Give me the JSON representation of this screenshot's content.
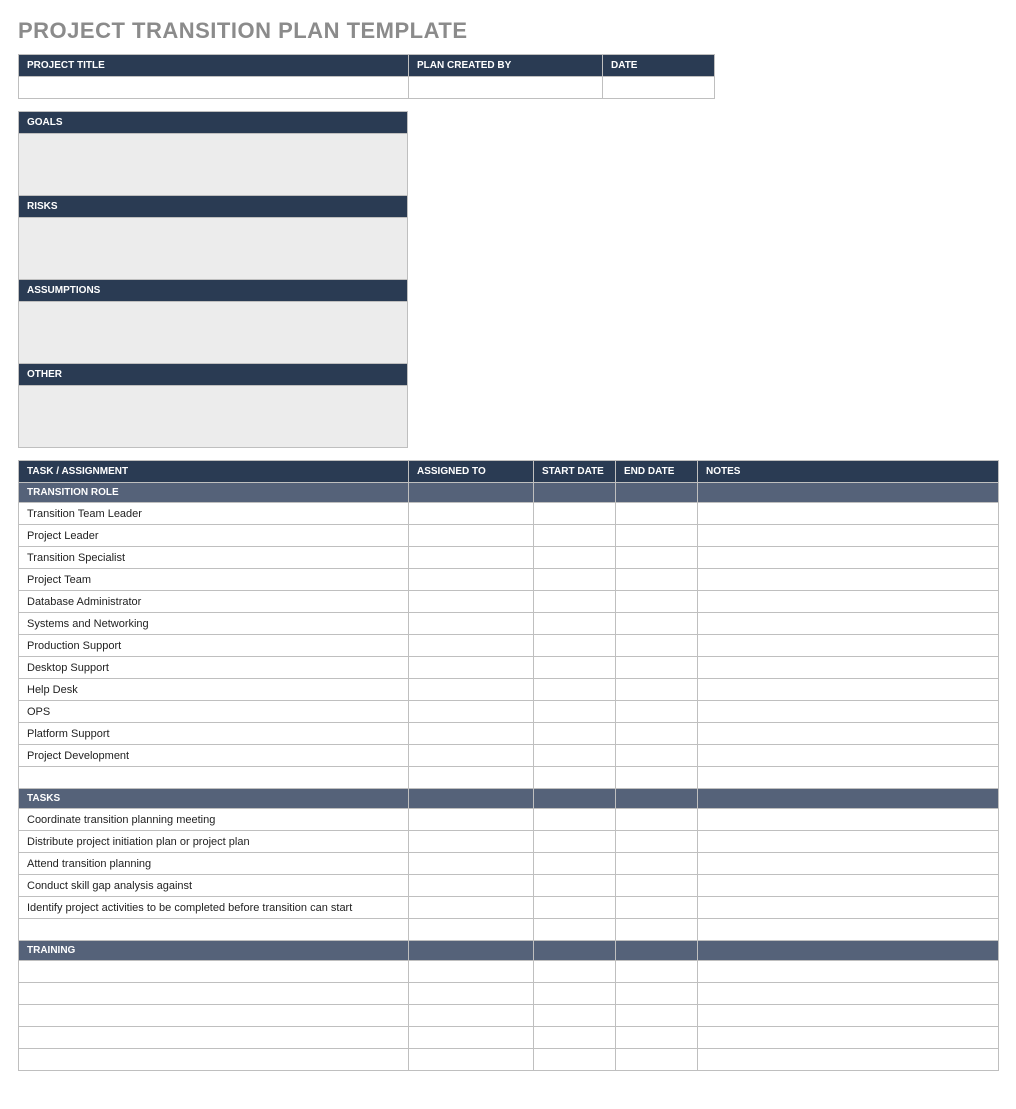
{
  "title": "PROJECT TRANSITION PLAN TEMPLATE",
  "info": {
    "headers": [
      "PROJECT TITLE",
      "PLAN CREATED BY",
      "DATE"
    ],
    "values": [
      "",
      "",
      ""
    ]
  },
  "blocks": [
    {
      "label": "GOALS",
      "value": ""
    },
    {
      "label": "RISKS",
      "value": ""
    },
    {
      "label": "ASSUMPTIONS",
      "value": ""
    },
    {
      "label": "OTHER",
      "value": ""
    }
  ],
  "main": {
    "headers": [
      "TASK / ASSIGNMENT",
      "ASSIGNED TO",
      "START DATE",
      "END DATE",
      "NOTES"
    ],
    "sections": [
      {
        "label": "TRANSITION ROLE",
        "rows": [
          [
            "Transition Team Leader",
            "",
            "",
            "",
            ""
          ],
          [
            "Project Leader",
            "",
            "",
            "",
            ""
          ],
          [
            "Transition Specialist",
            "",
            "",
            "",
            ""
          ],
          [
            "Project Team",
            "",
            "",
            "",
            ""
          ],
          [
            "Database Administrator",
            "",
            "",
            "",
            ""
          ],
          [
            "Systems and Networking",
            "",
            "",
            "",
            ""
          ],
          [
            "Production Support",
            "",
            "",
            "",
            ""
          ],
          [
            "Desktop Support",
            "",
            "",
            "",
            ""
          ],
          [
            "Help Desk",
            "",
            "",
            "",
            ""
          ],
          [
            "OPS",
            "",
            "",
            "",
            ""
          ],
          [
            "Platform Support",
            "",
            "",
            "",
            ""
          ],
          [
            "Project Development",
            "",
            "",
            "",
            ""
          ],
          [
            "",
            "",
            "",
            "",
            ""
          ]
        ]
      },
      {
        "label": "TASKS",
        "rows": [
          [
            "Coordinate transition planning meeting",
            "",
            "",
            "",
            ""
          ],
          [
            "Distribute project initiation plan or project plan",
            "",
            "",
            "",
            ""
          ],
          [
            "Attend transition planning",
            "",
            "",
            "",
            ""
          ],
          [
            "Conduct skill gap analysis against",
            "",
            "",
            "",
            ""
          ],
          [
            "Identify project activities to be completed before transition can start",
            "",
            "",
            "",
            ""
          ],
          [
            "",
            "",
            "",
            "",
            ""
          ]
        ]
      },
      {
        "label": "TRAINING",
        "rows": [
          [
            "",
            "",
            "",
            "",
            ""
          ],
          [
            "",
            "",
            "",
            "",
            ""
          ],
          [
            "",
            "",
            "",
            "",
            ""
          ],
          [
            "",
            "",
            "",
            "",
            ""
          ],
          [
            "",
            "",
            "",
            "",
            ""
          ]
        ]
      }
    ]
  }
}
